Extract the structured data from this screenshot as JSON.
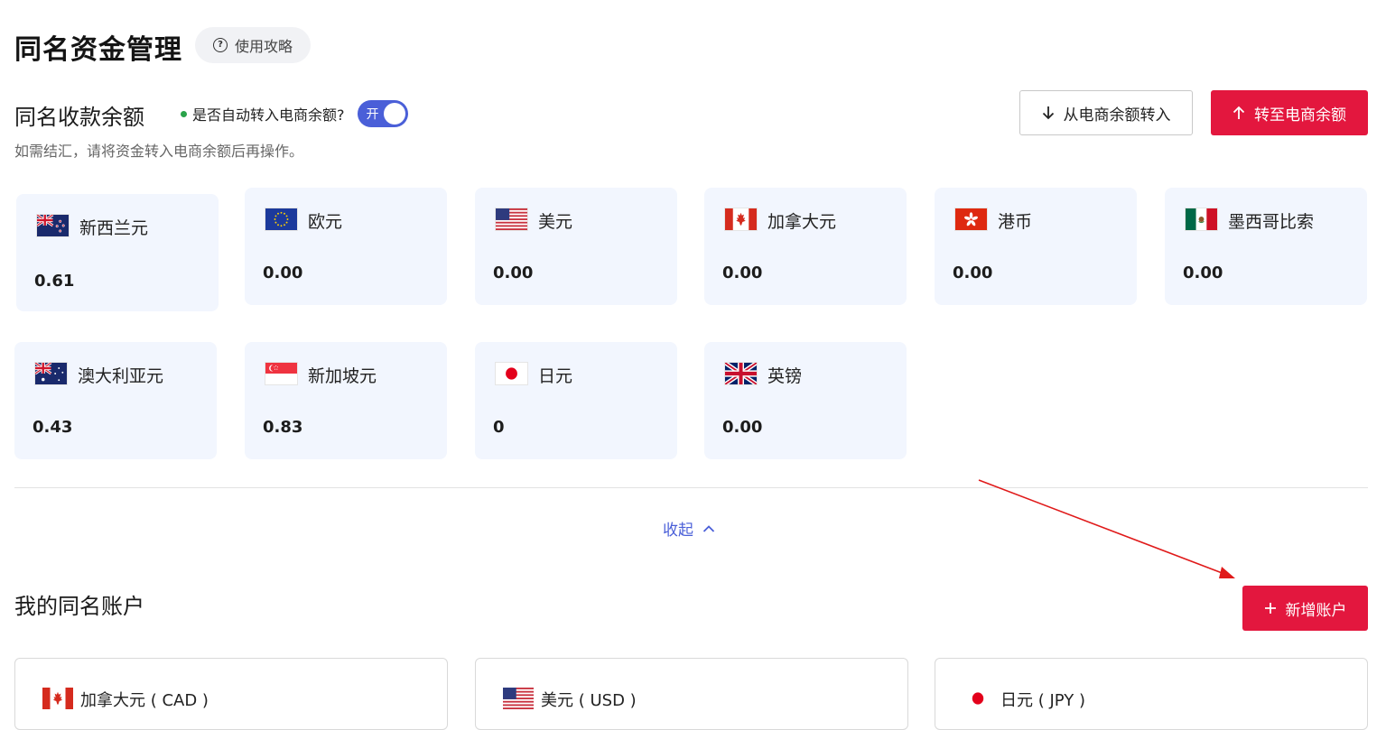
{
  "header": {
    "title": "同名资金管理",
    "guide_label": "使用攻略",
    "guide_icon": "question-circle-icon"
  },
  "balance_section": {
    "title": "同名收款余额",
    "auto_transfer_label": "是否自动转入电商余额?",
    "toggle_label": "开",
    "toggle_on": true,
    "hint": "如需结汇，请将资金转入电商余额后再操作。",
    "transfer_in_label": "从电商余额转入",
    "transfer_out_label": "转至电商余额"
  },
  "currencies": [
    {
      "name": "新西兰元",
      "amount": "0.61",
      "flag": "nz-flag-icon"
    },
    {
      "name": "欧元",
      "amount": "0.00",
      "flag": "eu-flag-icon"
    },
    {
      "name": "美元",
      "amount": "0.00",
      "flag": "us-flag-icon"
    },
    {
      "name": "加拿大元",
      "amount": "0.00",
      "flag": "ca-flag-icon"
    },
    {
      "name": "港币",
      "amount": "0.00",
      "flag": "hk-flag-icon"
    },
    {
      "name": "墨西哥比索",
      "amount": "0.00",
      "flag": "mx-flag-icon"
    },
    {
      "name": "澳大利亚元",
      "amount": "0.43",
      "flag": "au-flag-icon"
    },
    {
      "name": "新加坡元",
      "amount": "0.83",
      "flag": "sg-flag-icon"
    },
    {
      "name": "日元",
      "amount": "0",
      "flag": "jp-flag-icon"
    },
    {
      "name": "英镑",
      "amount": "0.00",
      "flag": "gb-flag-icon"
    }
  ],
  "collapse_label": "收起",
  "accounts_section": {
    "title": "我的同名账户",
    "add_label": "新增账户",
    "accounts": [
      {
        "name": "加拿大元 ( CAD )",
        "flag": "ca-flag-icon"
      },
      {
        "name": "美元 ( USD )",
        "flag": "us-flag-icon"
      },
      {
        "name": "日元 ( JPY )",
        "flag": "jp-flag-icon"
      }
    ]
  },
  "colors": {
    "primary_red": "#e3173e",
    "accent_blue": "#4a5fd8",
    "card_bg": "#f2f6fe",
    "annotation_arrow": "#e01a1a"
  }
}
